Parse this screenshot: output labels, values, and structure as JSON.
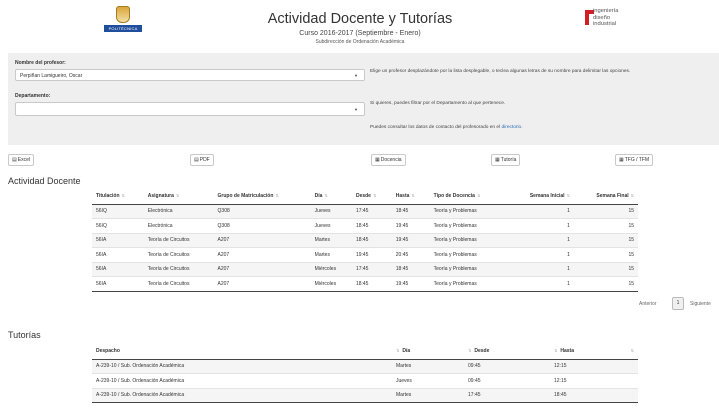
{
  "header": {
    "logo_text": "POLITÉCNICA",
    "title": "Actividad Docente y Tutorías",
    "course": "Curso 2016-2017 (Septiembre - Enero)",
    "subtitle": "Subdirección de Ordenación Académica",
    "ing_logo_line1": "ingeniería",
    "ing_logo_line2": "diseño",
    "ing_logo_line3": "industrial"
  },
  "filters": {
    "professor_label": "Nombre del profesor:",
    "professor_value": "Perpiñan Lamigueiro, Oscar",
    "department_label": "Departamento:",
    "department_value": "",
    "help_professor": "Elige un profesor desplazándote por la lista desplegable, o teclea algunas letras de su nombre para delimitar las opciones.",
    "help_department": "Si quieres, puedes filtrar por el Departamento al que pertenece.",
    "help_contact_prefix": "Puedes consultar los datos de contacto del profesorado en el",
    "help_contact_link": "directorio",
    "help_contact_suffix": "."
  },
  "buttons": {
    "excel": "Excel",
    "pdf": "PDF",
    "docencia": "Docencia",
    "tutoria": "Tutoría",
    "tfg": "TFG / TFM"
  },
  "activity": {
    "title": "Actividad Docente",
    "columns": [
      "Titulación",
      "Asignatura",
      "Grupo de Matriculación",
      "Día",
      "Desde",
      "Hasta",
      "Tipo de Docencia",
      "Semana Inicial",
      "Semana Final"
    ],
    "rows": [
      [
        "56IQ",
        "Electrónica",
        "Q308",
        "Jueves",
        "17:45",
        "18:45",
        "Teoría y Problemas",
        "1",
        "15"
      ],
      [
        "56IQ",
        "Electrónica",
        "Q308",
        "Jueves",
        "18:45",
        "19:45",
        "Teoría y Problemas",
        "1",
        "15"
      ],
      [
        "56IA",
        "Teoría de Circuitos",
        "A207",
        "Martes",
        "18:45",
        "19:45",
        "Teoría y Problemas",
        "1",
        "15"
      ],
      [
        "56IA",
        "Teoría de Circuitos",
        "A207",
        "Martes",
        "19:45",
        "20:45",
        "Teoría y Problemas",
        "1",
        "15"
      ],
      [
        "56IA",
        "Teoría de Circuitos",
        "A207",
        "Miércoles",
        "17:45",
        "18:45",
        "Teoría y Problemas",
        "1",
        "15"
      ],
      [
        "56IA",
        "Teoría de Circuitos",
        "A207",
        "Miércoles",
        "18:45",
        "19:45",
        "Teoría y Problemas",
        "1",
        "15"
      ]
    ]
  },
  "pagination": {
    "previous": "Anterior",
    "current": "1",
    "next": "Siguiente"
  },
  "tutorias": {
    "title": "Tutorías",
    "columns": [
      "Despacho",
      "Día",
      "Desde",
      "Hasta"
    ],
    "rows": [
      [
        "A-239-10 / Sub. Ordenación Académica",
        "Martes",
        "09:45",
        "12:15"
      ],
      [
        "A-239-10 / Sub. Ordenación Académica",
        "Jueves",
        "09:45",
        "12:15"
      ],
      [
        "A-239-10 / Sub. Ordenación Académica",
        "Martes",
        "17:45",
        "18:45"
      ]
    ]
  }
}
